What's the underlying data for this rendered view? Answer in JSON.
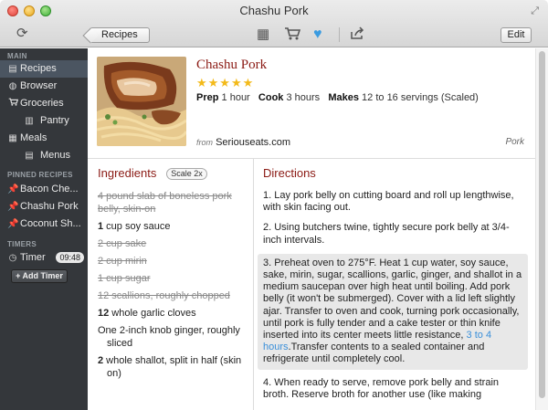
{
  "window": {
    "title": "Chashu Pork"
  },
  "toolbar": {
    "back_label": "Recipes",
    "edit_label": "Edit",
    "icons": [
      "sync-icon",
      "calendar-icon",
      "cart-icon",
      "heart-icon",
      "share-icon"
    ],
    "heart_color": "#3a9be0"
  },
  "sidebar": {
    "main_heading": "MAIN",
    "items": [
      {
        "label": "Recipes",
        "icon": "recipes-icon",
        "selected": true
      },
      {
        "label": "Browser",
        "icon": "globe-icon"
      },
      {
        "label": "Groceries",
        "icon": "cart-icon"
      },
      {
        "label": "Pantry",
        "icon": "pantry-icon"
      },
      {
        "label": "Meals",
        "icon": "calendar-icon"
      },
      {
        "label": "Menus",
        "icon": "menu-icon"
      }
    ],
    "pinned_heading": "PINNED RECIPES",
    "pinned": [
      {
        "label": "Bacon Che...",
        "icon": "pin-icon"
      },
      {
        "label": "Chashu Pork",
        "icon": "pin-icon"
      },
      {
        "label": "Coconut Sh...",
        "icon": "pin-icon"
      }
    ],
    "timers_heading": "TIMERS",
    "timer": {
      "label": "Timer",
      "value": "09:48"
    },
    "add_timer_label": "+ Add Timer"
  },
  "recipe": {
    "title": "Chashu Pork",
    "rating": 5,
    "stars": "★★★★★",
    "prep_label": "Prep",
    "prep_value": "1 hour",
    "cook_label": "Cook",
    "cook_value": "3 hours",
    "makes_label": "Makes",
    "makes_value": "12 to 16 servings (Scaled)",
    "source_prefix": "from",
    "source": "Seriouseats.com",
    "category": "Pork"
  },
  "ingredients": {
    "title": "Ingredients",
    "scale_label": "Scale 2x",
    "items": [
      {
        "text": "4 pound slab of boneless pork belly, skin-on",
        "done": true
      },
      {
        "qty": "1",
        "text": " cup soy sauce",
        "done": false
      },
      {
        "text": "2 cup sake",
        "done": true
      },
      {
        "text": "2 cup mirin",
        "done": true
      },
      {
        "text": "1 cup sugar",
        "done": true
      },
      {
        "text": "12 scallions, roughly chopped",
        "done": true
      },
      {
        "qty": "12",
        "text": " whole garlic cloves",
        "done": false
      },
      {
        "text": "One 2-inch knob ginger, roughly sliced",
        "done": false
      },
      {
        "qty": "2",
        "text": " whole shallot, split in half (skin on)",
        "done": false
      }
    ]
  },
  "directions": {
    "title": "Directions",
    "steps": [
      {
        "text": "1. Lay pork belly on cutting board and roll up lengthwise, with skin facing out."
      },
      {
        "text": "2. Using butchers twine, tightly secure pork belly at 3/4-inch intervals."
      },
      {
        "text_before": "3. Preheat oven to 275°F. Heat 1 cup water, soy sauce, sake, mirin, sugar, scallions, garlic, ginger, and shallot in a medium saucepan over high heat until boiling. Add pork belly (it won't be submerged). Cover with a lid left slightly ajar. Transfer to oven and cook, turning pork occasionally, until pork is fully tender and a cake tester or thin knife inserted into its center meets little resistance, ",
        "link": "3 to 4 hours",
        "text_after": ".Transfer contents to a sealed container and refrigerate until completely cool.",
        "highlighted": true
      },
      {
        "text": "4. When ready to serve, remove pork belly and strain broth. Reserve broth for another use (like making"
      }
    ]
  },
  "colors": {
    "accent_red": "#8b1a14",
    "star_gold": "#f3ba1a",
    "link_blue": "#3a8fd9",
    "sidebar_bg": "#34373b"
  }
}
